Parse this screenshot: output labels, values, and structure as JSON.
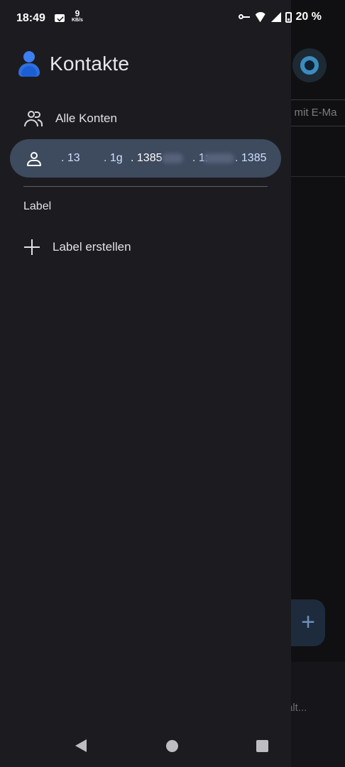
{
  "status_bar": {
    "time": "18:49",
    "net_speed_value": "9",
    "net_speed_unit": "KB/s",
    "battery": "20 %",
    "icons": [
      "mail-icon",
      "vpn-key-icon",
      "wifi-icon",
      "signal-icon",
      "battery-icon"
    ]
  },
  "drawer": {
    "app_title": "Kontakte",
    "all_accounts_label": "Alle Konten",
    "account_fragments": [
      ". 13",
      ". 1g",
      ". 1385",
      ". 1:",
      ". 1385"
    ],
    "section_label": "Label",
    "create_label": "Label erstellen"
  },
  "background": {
    "search_text": "e mit E-Ma",
    "bottom_text": "alt..."
  },
  "colors": {
    "drawer_bg": "#1c1c20",
    "selected_bg": "#3e4a5e",
    "accent": "#3d7ef2"
  }
}
